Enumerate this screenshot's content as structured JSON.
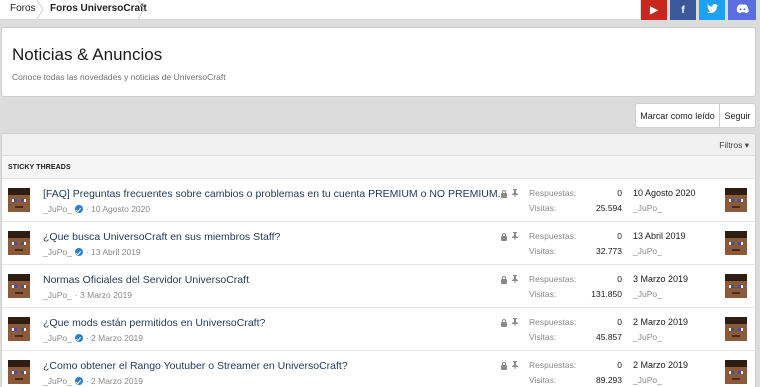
{
  "breadcrumb": [
    "Foros",
    "Foros UniversoCraft"
  ],
  "social": {
    "youtube": {
      "icon": "youtube-icon",
      "glyph": "▶",
      "color": "#c8271e"
    },
    "facebook": {
      "icon": "facebook-icon",
      "glyph": "f",
      "color": "#3b5998"
    },
    "twitter": {
      "icon": "twitter-icon",
      "glyph": "🐦",
      "color": "#1da1f2"
    },
    "discord": {
      "icon": "discord-icon",
      "glyph": "◉",
      "color": "#5a6ee0"
    }
  },
  "header": {
    "title": "Noticias & Anuncios",
    "description": "Conoce todas las novedades y noticias de UniversoCraft"
  },
  "actions": {
    "mark_read": "Marcar como leído",
    "follow": "Seguir"
  },
  "filters_label": "Filtros ▾",
  "section_label": "STICKY THREADS",
  "labels": {
    "replies": "Respuestas:",
    "views": "Visitas:"
  },
  "threads": [
    {
      "title": "[FAQ] Preguntas frecuentes sobre cambios o problemas en tu cuenta PREMIUM o NO PREMIUM.",
      "author": "_JuPo_",
      "date": "· 10 Agosto 2020",
      "replies": "0",
      "views": "25.594",
      "last_date": "10 Agosto 2020",
      "last_user": "_JuPo_",
      "verified": true
    },
    {
      "title": "¿Que busca UniversoCraft en sus miembros Staff?",
      "author": "_JuPo_",
      "date": "· 13 Abril 2019",
      "replies": "0",
      "views": "32.773",
      "last_date": "13 Abril 2019",
      "last_user": "_JuPo_",
      "verified": true
    },
    {
      "title": "Normas Oficiales del Servidor UniversoCraft",
      "author": "_JuPo_",
      "date": "· 3 Marzo 2019",
      "replies": "0",
      "views": "131.850",
      "last_date": "3 Marzo 2019",
      "last_user": "_JuPo_",
      "verified": false
    },
    {
      "title": "¿Que mods están permitidos en UniversoCraft?",
      "author": "_JuPo_",
      "date": "· 2 Marzo 2019",
      "replies": "0",
      "views": "45.857",
      "last_date": "2 Marzo 2019",
      "last_user": "_JuPo_",
      "verified": true
    },
    {
      "title": "¿Como obtener el Rango Youtuber o Streamer en UniversoCraft?",
      "author": "_JuPo_",
      "date": "· 2 Marzo 2019",
      "replies": "0",
      "views": "89.293",
      "last_date": "2 Marzo 2019",
      "last_user": "_JuPo_",
      "verified": true
    }
  ]
}
